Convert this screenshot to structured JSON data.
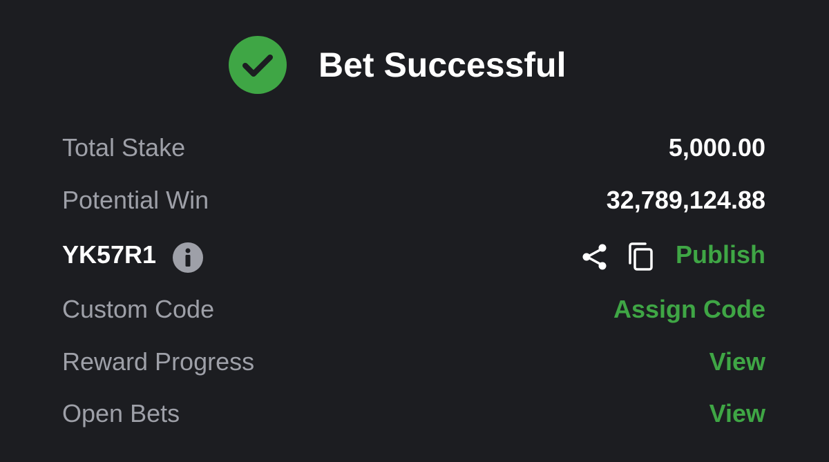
{
  "header": {
    "title": "Bet Successful",
    "icon": "check-circle-icon",
    "accent_color": "#3fa645"
  },
  "rows": {
    "total_stake": {
      "label": "Total Stake",
      "value": "5,000.00"
    },
    "potential_win": {
      "label": "Potential Win",
      "value": "32,789,124.88"
    },
    "booking": {
      "code": "YK57R1",
      "info_icon": "info-icon",
      "share_icon": "share-icon",
      "copy_icon": "copy-icon",
      "publish_label": "Publish"
    },
    "custom_code": {
      "label": "Custom Code",
      "action": "Assign Code"
    },
    "reward_progress": {
      "label": "Reward Progress",
      "action": "View"
    },
    "open_bets": {
      "label": "Open Bets",
      "action": "View"
    }
  },
  "colors": {
    "background": "#1c1d21",
    "label": "#9ea0a8",
    "value": "#ffffff",
    "link": "#3fa645"
  }
}
